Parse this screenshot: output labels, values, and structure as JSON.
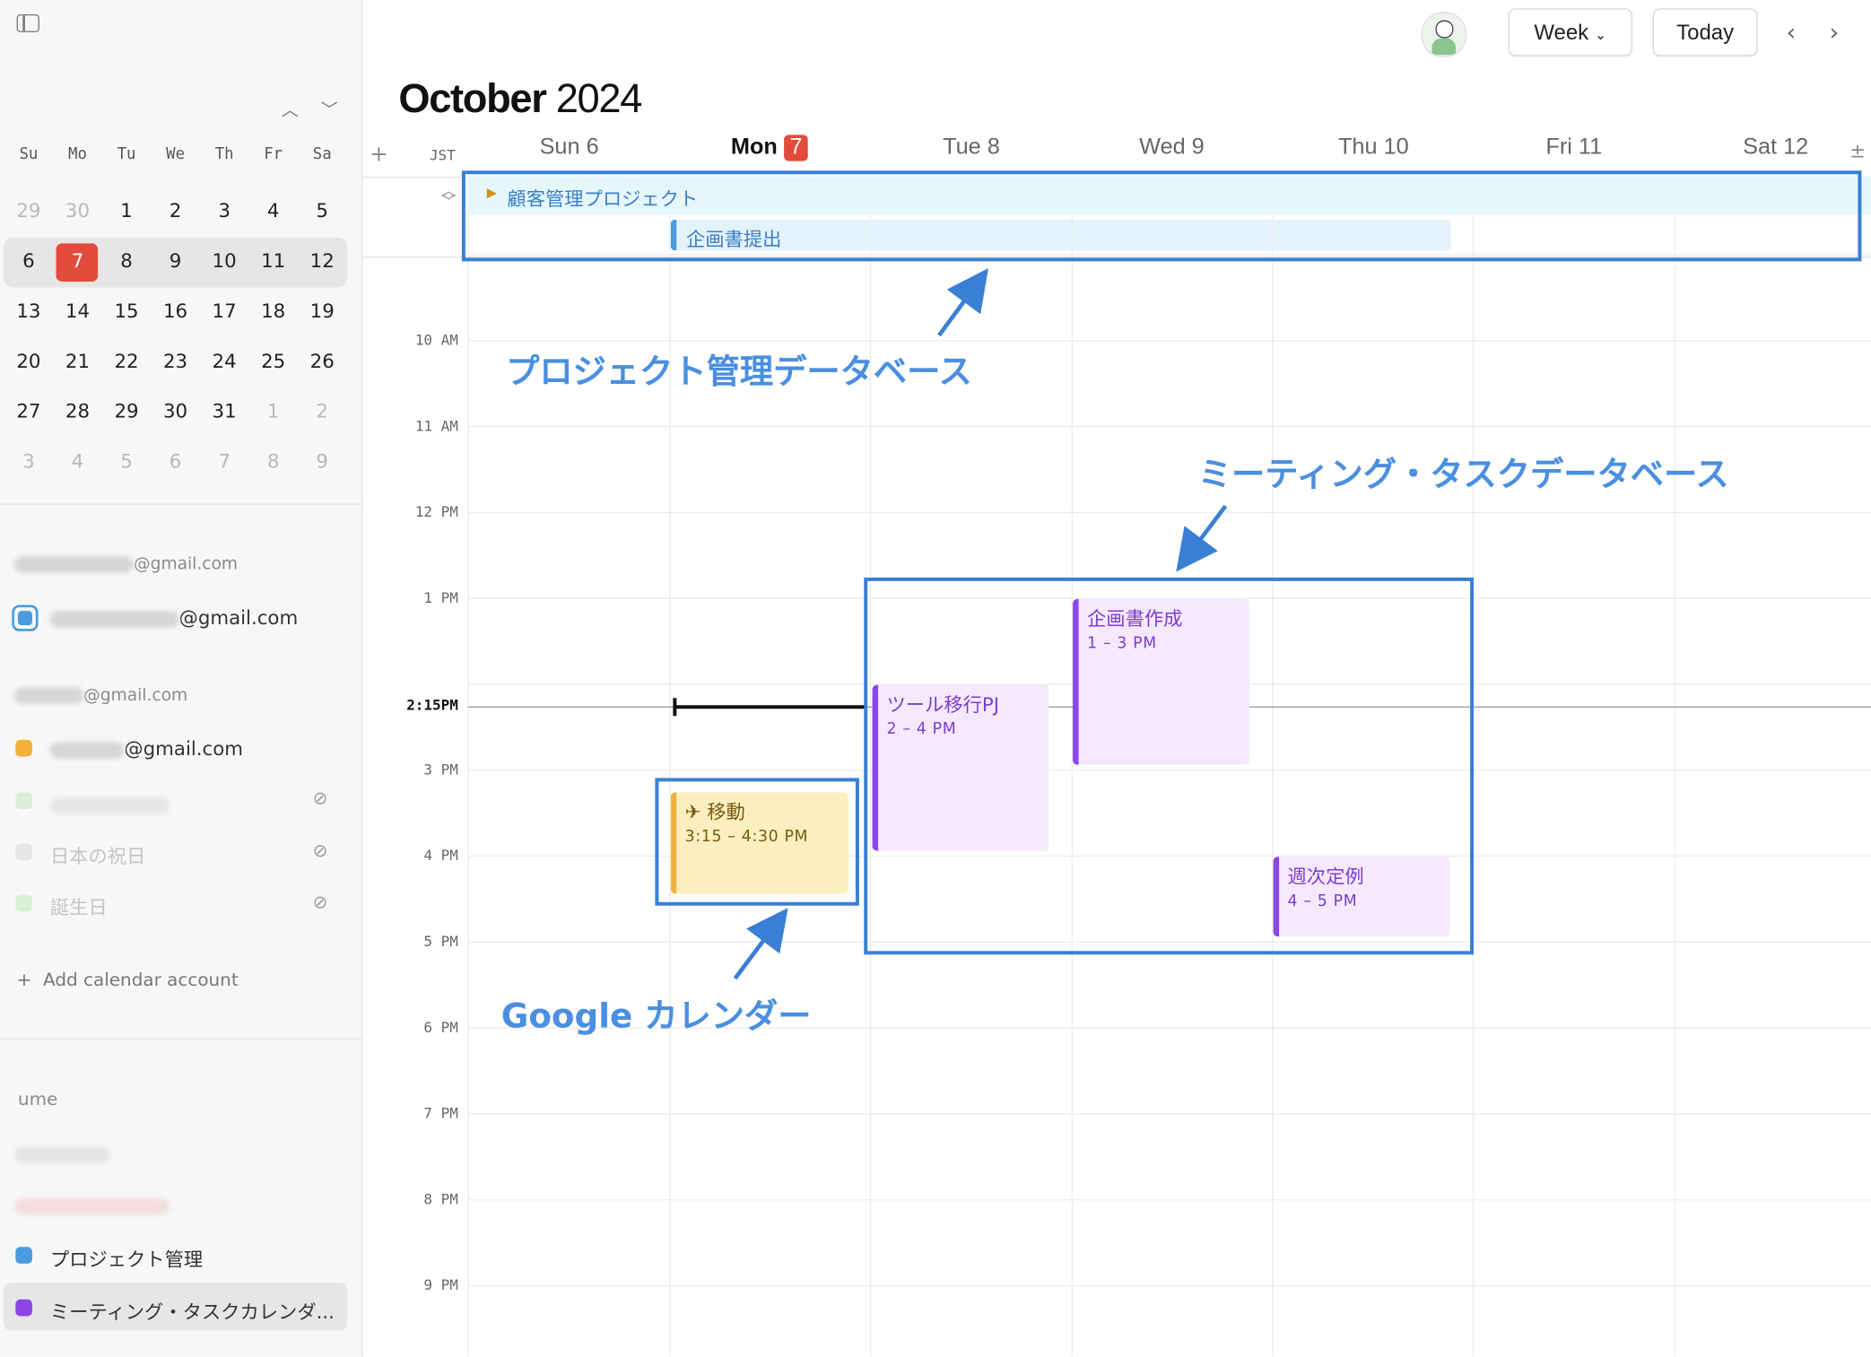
{
  "sidebar": {
    "month_weekdays": [
      "Su",
      "Mo",
      "Tu",
      "We",
      "Th",
      "Fr",
      "Sa"
    ],
    "mini_weeks": [
      [
        "29",
        "30",
        "1",
        "2",
        "3",
        "4",
        "5"
      ],
      [
        "6",
        "7",
        "8",
        "9",
        "10",
        "11",
        "12"
      ],
      [
        "13",
        "14",
        "15",
        "16",
        "17",
        "18",
        "19"
      ],
      [
        "20",
        "21",
        "22",
        "23",
        "24",
        "25",
        "26"
      ],
      [
        "27",
        "28",
        "29",
        "30",
        "31",
        "1",
        "2"
      ],
      [
        "3",
        "4",
        "5",
        "6",
        "7",
        "8",
        "9"
      ]
    ],
    "account1_label": "@gmail.com",
    "account1_calendar": "@gmail.com",
    "account2_label": "@gmail.com",
    "account2_calendar": "@gmail.com",
    "hidden_calendar_1": "日本の祝日",
    "hidden_calendar_2": "誕生日",
    "add_account": "Add calendar account",
    "workspace_label": "ume",
    "calendar_project": "プロジェクト管理",
    "calendar_meeting": "ミーティング・タスクカレンダ...",
    "colors": {
      "blue": "#4a9be0",
      "yellow": "#f2b23a",
      "purple": "#8b46e8"
    }
  },
  "header": {
    "view_label": "Week",
    "today_label": "Today",
    "month": "October",
    "year": "2024",
    "timezone": "JST",
    "days": [
      {
        "name": "Sun",
        "num": "6"
      },
      {
        "name": "Mon",
        "num": "7"
      },
      {
        "name": "Tue",
        "num": "8"
      },
      {
        "name": "Wed",
        "num": "9"
      },
      {
        "name": "Thu",
        "num": "10"
      },
      {
        "name": "Fri",
        "num": "11"
      },
      {
        "name": "Sat",
        "num": "12"
      }
    ]
  },
  "allday": {
    "group": "顧客管理プロジェクト",
    "event": "企画書提出"
  },
  "hours": [
    "10 AM",
    "11 AM",
    "12 PM",
    "1 PM",
    "3 PM",
    "4 PM",
    "5 PM",
    "6 PM",
    "7 PM",
    "8 PM",
    "9 PM"
  ],
  "current_time": "2:15PM",
  "events": {
    "idou": {
      "title": "移動",
      "time": "3:15 – 4:30 PM"
    },
    "tool": {
      "title": "ツール移行PJ",
      "time": "2 – 4 PM"
    },
    "kikaku": {
      "title": "企画書作成",
      "time": "1 – 3 PM"
    },
    "weekly": {
      "title": "週次定例",
      "time": "4 – 5 PM"
    }
  },
  "annotations": {
    "project_db": "プロジェクト管理データベース",
    "meeting_db": "ミーティング・タスクデータベース",
    "google_cal": "Google カレンダー"
  }
}
